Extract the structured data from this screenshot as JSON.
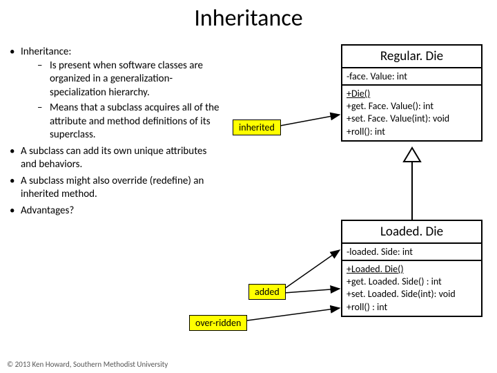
{
  "title": "Inheritance",
  "bullets": {
    "b1": "Inheritance:",
    "b1_1": "Is present when software classes are organized in a generalization-specialization hierarchy.",
    "b1_2": "Means that a subclass acquires all of the attribute and method definitions of its superclass.",
    "b2": "A subclass can add its own unique attributes and behaviors.",
    "b3": "A subclass might also override (redefine) an inherited method.",
    "b4": "Advantages?"
  },
  "callouts": {
    "inherited": "inherited",
    "added": "added",
    "overridden": "over-ridden"
  },
  "uml": {
    "regular": {
      "name": "Regular. Die",
      "attr1": "-face. Value: int",
      "op1": "+Die()",
      "op2": "+get. Face. Value(): int",
      "op3": "+set. Face. Value(int): void",
      "op4": "+roll(): int"
    },
    "loaded": {
      "name": "Loaded. Die",
      "attr1": "-loaded. Side: int",
      "op1": "+Loaded. Die()",
      "op2": "+get. Loaded. Side() : int",
      "op3": "+set. Loaded. Side(int): void",
      "op4": "+roll() : int"
    }
  },
  "footer": "© 2013 Ken Howard, Southern Methodist University"
}
